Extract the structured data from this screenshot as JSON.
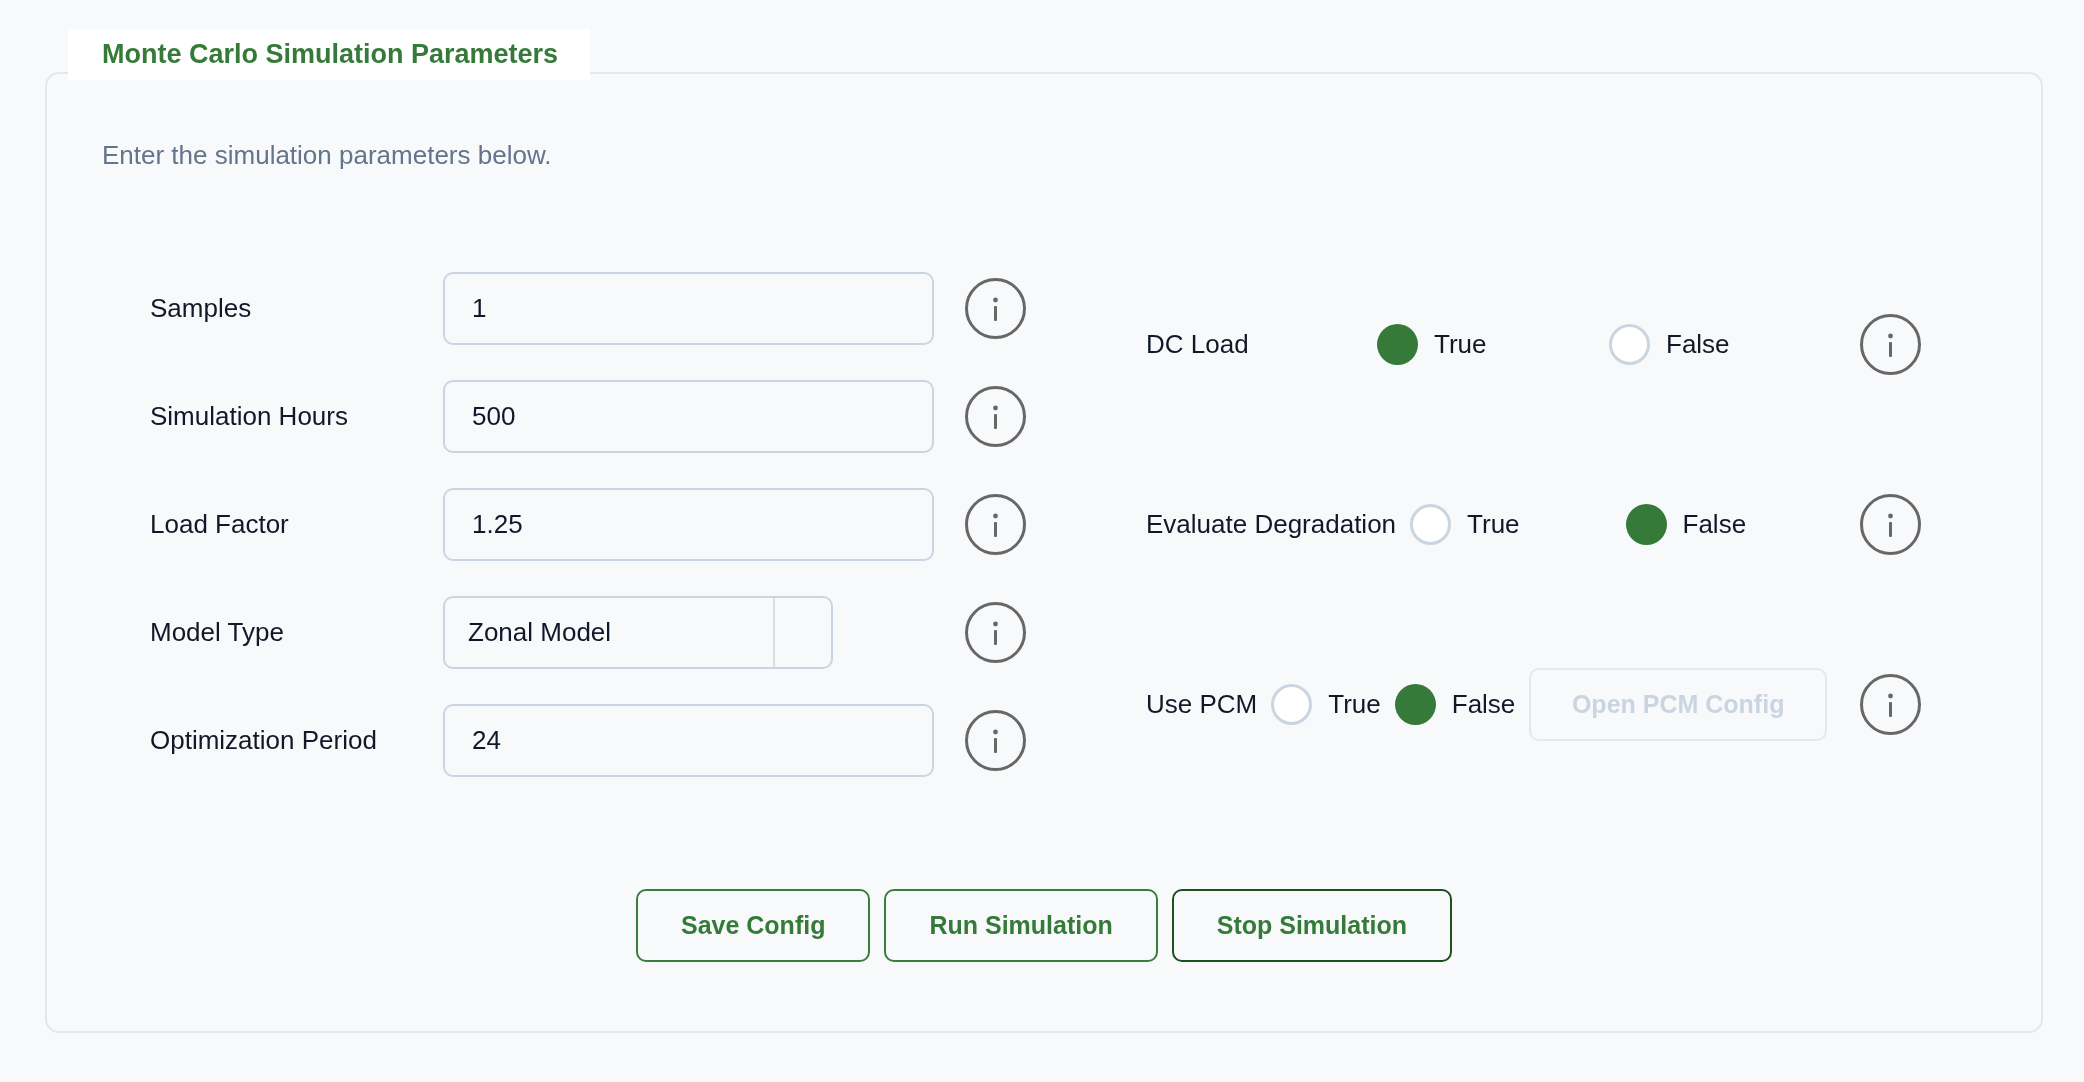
{
  "title": "Monte Carlo Simulation Parameters",
  "description": "Enter the simulation parameters below.",
  "fields": [
    {
      "kind": "text",
      "label": "Samples",
      "value": "1"
    },
    {
      "kind": "text",
      "label": "Simulation Hours",
      "value": "500"
    },
    {
      "kind": "text",
      "label": "Load Factor",
      "value": "1.25"
    },
    {
      "kind": "select",
      "label": "Model Type",
      "value": "Zonal Model"
    },
    {
      "kind": "text",
      "label": "Optimization Period",
      "value": "24"
    }
  ],
  "toggles": [
    {
      "kind": "radio",
      "label": "DC Load",
      "options": [
        {
          "label": "True",
          "selected": true
        },
        {
          "label": "False",
          "selected": false
        }
      ]
    },
    {
      "kind": "radio",
      "label": "Evaluate Degradation",
      "options": [
        {
          "label": "True",
          "selected": false
        },
        {
          "label": "False",
          "selected": true
        }
      ]
    },
    {
      "kind": "radio_with_button",
      "label": "Use PCM",
      "options": [
        {
          "label": "True",
          "selected": false
        },
        {
          "label": "False",
          "selected": true
        }
      ],
      "button": {
        "label": "Open PCM Config",
        "disabled": true
      }
    }
  ],
  "buttons": [
    {
      "label": "Save Config",
      "focused": false
    },
    {
      "label": "Run Simulation",
      "focused": false
    },
    {
      "label": "Stop Simulation",
      "focused": true
    }
  ]
}
